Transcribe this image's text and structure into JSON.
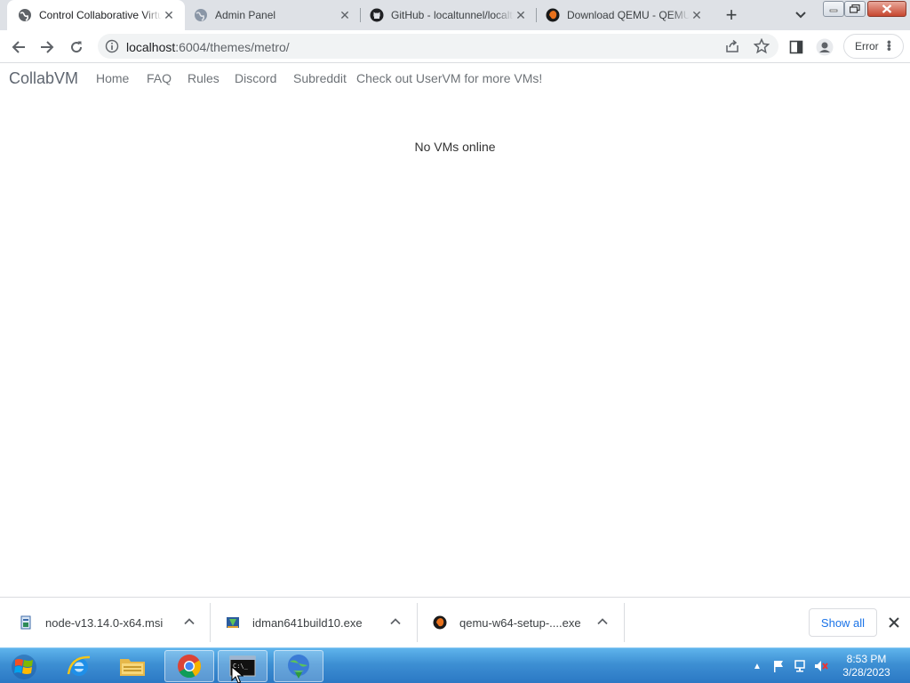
{
  "browser": {
    "tabs": [
      {
        "title": "Control Collaborative Virtual Machines",
        "active": true,
        "favicon": "globe-icon"
      },
      {
        "title": "Admin Panel",
        "active": false,
        "favicon": "globe-icon"
      },
      {
        "title": "GitHub - localtunnel/localtunnel",
        "active": false,
        "favicon": "github-icon"
      },
      {
        "title": "Download QEMU - QEMU",
        "active": false,
        "favicon": "qemu-icon"
      }
    ],
    "address": {
      "host": "localhost",
      "path": ":6004/themes/metro/"
    },
    "error_label": "Error"
  },
  "page": {
    "brand": "CollabVM",
    "nav": [
      "Home",
      "FAQ",
      "Rules",
      "Discord",
      "Subreddit",
      "Check out UserVM for more VMs!"
    ],
    "message": "No VMs online"
  },
  "downloads": {
    "items": [
      {
        "name": "node-v13.14.0-x64.msi",
        "icon": "msi-installer-icon"
      },
      {
        "name": "idman641build10.exe",
        "icon": "idm-installer-icon"
      },
      {
        "name": "qemu-w64-setup-....exe",
        "icon": "qemu-icon"
      }
    ],
    "show_all": "Show all"
  },
  "taskbar": {
    "apps": [
      "internet-explorer",
      "file-explorer",
      "chrome",
      "command-prompt",
      "internet-download-manager"
    ],
    "clock": {
      "time": "8:53 PM",
      "date": "3/28/2023"
    }
  },
  "colors": {
    "tabstrip_bg": "#dee1e6",
    "accent_blue": "#1a73e8",
    "taskbar_blue": "#3d8fd3"
  }
}
